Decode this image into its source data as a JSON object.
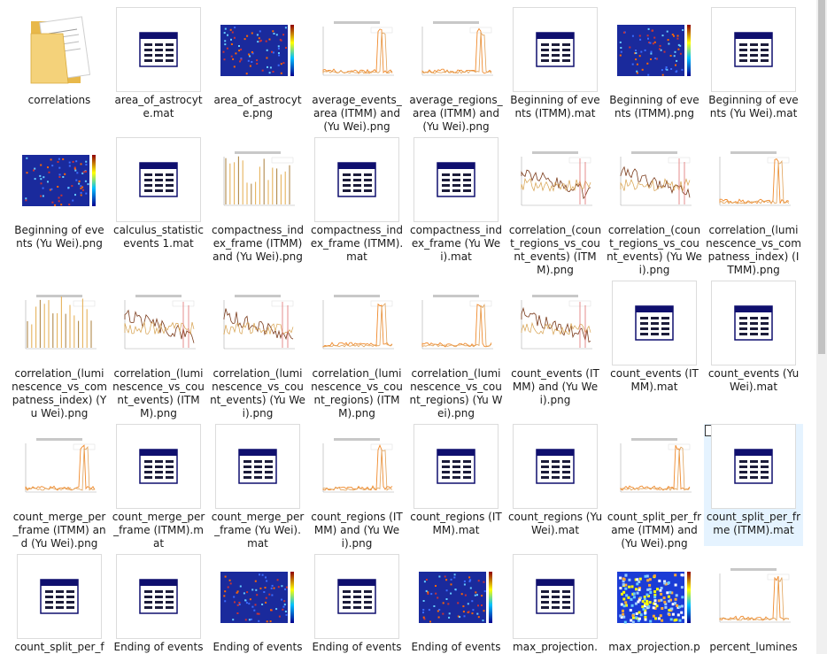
{
  "window": {
    "view": "Large icons"
  },
  "files": [
    {
      "name": "correlations",
      "kind": "folder",
      "icon": "folder-icon"
    },
    {
      "name": "area_of_astrocyte.mat",
      "kind": "mat",
      "icon": "mat-file-icon"
    },
    {
      "name": "area_of_astrocyte.png",
      "kind": "png",
      "icon": "heatmap-thumbnail",
      "thumb": "heatmap"
    },
    {
      "name": "average_events_area (ITMM) and (Yu Wei).png",
      "kind": "png",
      "icon": "line-plot-thumbnail",
      "thumb": "spikes"
    },
    {
      "name": "average_regions_area (ITMM) and (Yu Wei).png",
      "kind": "png",
      "icon": "line-plot-thumbnail",
      "thumb": "spikes"
    },
    {
      "name": "Beginning of events (ITMM).mat",
      "kind": "mat",
      "icon": "mat-file-icon"
    },
    {
      "name": "Beginning of events (ITMM).png",
      "kind": "png",
      "icon": "heatmap-thumbnail",
      "thumb": "heatmap"
    },
    {
      "name": "Beginning of events (Yu Wei).mat",
      "kind": "mat",
      "icon": "mat-file-icon"
    },
    {
      "name": "Beginning of events (Yu Wei).png",
      "kind": "png",
      "icon": "heatmap-thumbnail",
      "thumb": "heatmap"
    },
    {
      "name": "calculus_statistic events 1.mat",
      "kind": "mat",
      "icon": "mat-file-icon"
    },
    {
      "name": "compactness_index_frame (ITMM) and (Yu Wei).png",
      "kind": "png",
      "icon": "line-plot-thumbnail",
      "thumb": "bars"
    },
    {
      "name": "compactness_index_frame (ITMM).mat",
      "kind": "mat",
      "icon": "mat-file-icon"
    },
    {
      "name": "compactness_index_frame (Yu Wei).mat",
      "kind": "mat",
      "icon": "mat-file-icon"
    },
    {
      "name": "correlation_(count_regions_vs_count_events) (ITMM).png",
      "kind": "png",
      "icon": "line-plot-thumbnail",
      "thumb": "noisy"
    },
    {
      "name": "correlation_(count_regions_vs_count_events) (Yu Wei).png",
      "kind": "png",
      "icon": "line-plot-thumbnail",
      "thumb": "noisy"
    },
    {
      "name": "correlation_(luminescence_vs_compatness_index) (ITMM).png",
      "kind": "png",
      "icon": "line-plot-thumbnail",
      "thumb": "spikes"
    },
    {
      "name": "correlation_(luminescence_vs_compatness_index) (Yu Wei).png",
      "kind": "png",
      "icon": "line-plot-thumbnail",
      "thumb": "bars"
    },
    {
      "name": "correlation_(luminescence_vs_count_events) (ITMM).png",
      "kind": "png",
      "icon": "line-plot-thumbnail",
      "thumb": "noisy"
    },
    {
      "name": "correlation_(luminescence_vs_count_events) (Yu Wei).png",
      "kind": "png",
      "icon": "line-plot-thumbnail",
      "thumb": "noisy"
    },
    {
      "name": "correlation_(luminescence_vs_count_regions) (ITMM).png",
      "kind": "png",
      "icon": "line-plot-thumbnail",
      "thumb": "spikes"
    },
    {
      "name": "correlation_(luminescence_vs_count_regions) (Yu Wei).png",
      "kind": "png",
      "icon": "line-plot-thumbnail",
      "thumb": "spikes"
    },
    {
      "name": "count_events (ITMM) and (Yu Wei).png",
      "kind": "png",
      "icon": "line-plot-thumbnail",
      "thumb": "noisy"
    },
    {
      "name": "count_events (ITMM).mat",
      "kind": "mat",
      "icon": "mat-file-icon"
    },
    {
      "name": "count_events (Yu Wei).mat",
      "kind": "mat",
      "icon": "mat-file-icon"
    },
    {
      "name": "count_merge_per_frame (ITMM) and (Yu Wei).png",
      "kind": "png",
      "icon": "line-plot-thumbnail",
      "thumb": "spikes"
    },
    {
      "name": "count_merge_per_frame (ITMM).mat",
      "kind": "mat",
      "icon": "mat-file-icon"
    },
    {
      "name": "count_merge_per_frame (Yu Wei).mat",
      "kind": "mat",
      "icon": "mat-file-icon"
    },
    {
      "name": "count_regions (ITMM) and (Yu Wei).png",
      "kind": "png",
      "icon": "line-plot-thumbnail",
      "thumb": "spikes"
    },
    {
      "name": "count_regions (ITMM).mat",
      "kind": "mat",
      "icon": "mat-file-icon"
    },
    {
      "name": "count_regions (Yu Wei).mat",
      "kind": "mat",
      "icon": "mat-file-icon"
    },
    {
      "name": "count_split_per_frame (ITMM) and (Yu Wei).png",
      "kind": "png",
      "icon": "line-plot-thumbnail",
      "thumb": "spikes"
    },
    {
      "name": "count_split_per_frme (ITMM).mat",
      "kind": "mat",
      "icon": "mat-file-icon",
      "selected": true
    },
    {
      "name": "count_split_per_f",
      "kind": "mat",
      "icon": "mat-file-icon"
    },
    {
      "name": "Ending of events",
      "kind": "mat",
      "icon": "mat-file-icon"
    },
    {
      "name": "Ending of events",
      "kind": "png",
      "icon": "heatmap-thumbnail",
      "thumb": "heatmap"
    },
    {
      "name": "Ending of events",
      "kind": "mat",
      "icon": "mat-file-icon"
    },
    {
      "name": "Ending of events",
      "kind": "png",
      "icon": "heatmap-thumbnail",
      "thumb": "heatmap"
    },
    {
      "name": "max_projection.",
      "kind": "mat",
      "icon": "mat-file-icon"
    },
    {
      "name": "max_projection.p",
      "kind": "png",
      "icon": "heatmap-thumbnail",
      "thumb": "bright"
    },
    {
      "name": "percent_lumines",
      "kind": "png",
      "icon": "line-plot-thumbnail",
      "thumb": "spikes"
    }
  ],
  "colors": {
    "selection": "#e5f3ff",
    "mat_header": "#0f0f6e",
    "heatmap_bg": "#1a2a9c",
    "plot_orange": "#f08a2c",
    "plot_brown": "#7a3a1a"
  }
}
